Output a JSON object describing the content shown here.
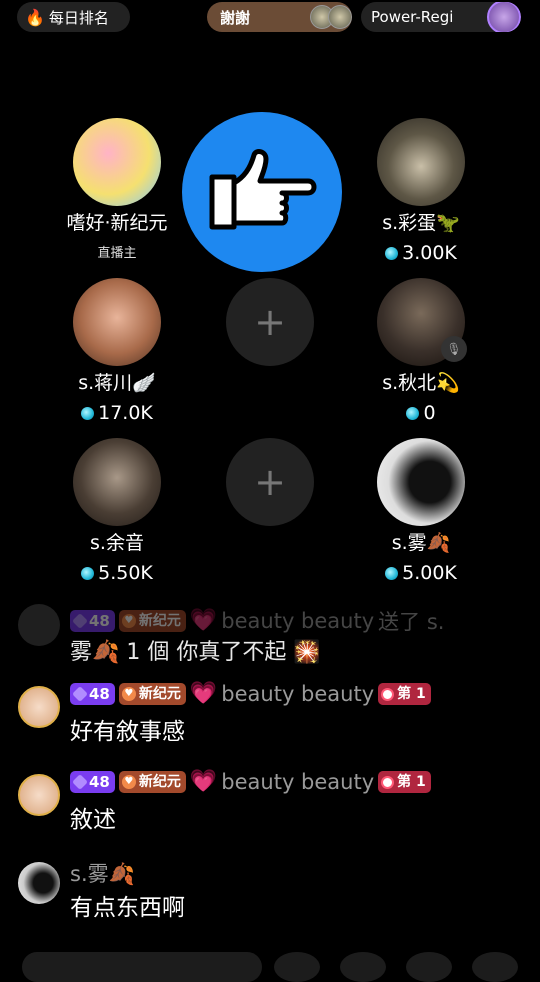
{
  "top_bar": {
    "rank_label": "每日排名",
    "gift_label": "謝謝",
    "power_label": "Power-Regi"
  },
  "host": {
    "name": "嗜好·新纪元",
    "role": "直播主"
  },
  "seats": [
    {
      "name": "s.彩蛋🦖",
      "score": "3.00K"
    },
    {
      "name": "s.蒋川🪽",
      "score": "17.0K"
    },
    {
      "name": "s.秋北💫",
      "score": "0"
    },
    {
      "name": "s.余音",
      "score": "5.50K"
    },
    {
      "name": "s.雾🍂",
      "score": "5.00K"
    }
  ],
  "empty_seat_symbol": "+",
  "chat": {
    "partial": {
      "level": "48",
      "fan_club": "新纪元",
      "username": "beauty beauty",
      "text_prefix": "送了 s.",
      "text": "雾🍂 1 個 你真了不起 🎇"
    },
    "messages": [
      {
        "level": "48",
        "fan_club": "新纪元",
        "username": "beauty beauty",
        "rank": "第 1",
        "text": "好有敘事感"
      },
      {
        "level": "48",
        "fan_club": "新纪元",
        "username": "beauty beauty",
        "rank": "第 1",
        "text": "敘述"
      },
      {
        "username": "s.雾🍂",
        "text": "有点东西啊"
      }
    ]
  },
  "colors": {
    "pointer_badge": "#1e88f0",
    "level_badge": "#7a3df0",
    "fan_badge": "#a34a2c",
    "rank_badge": "#b0263f",
    "gem": "#22b8d8"
  }
}
